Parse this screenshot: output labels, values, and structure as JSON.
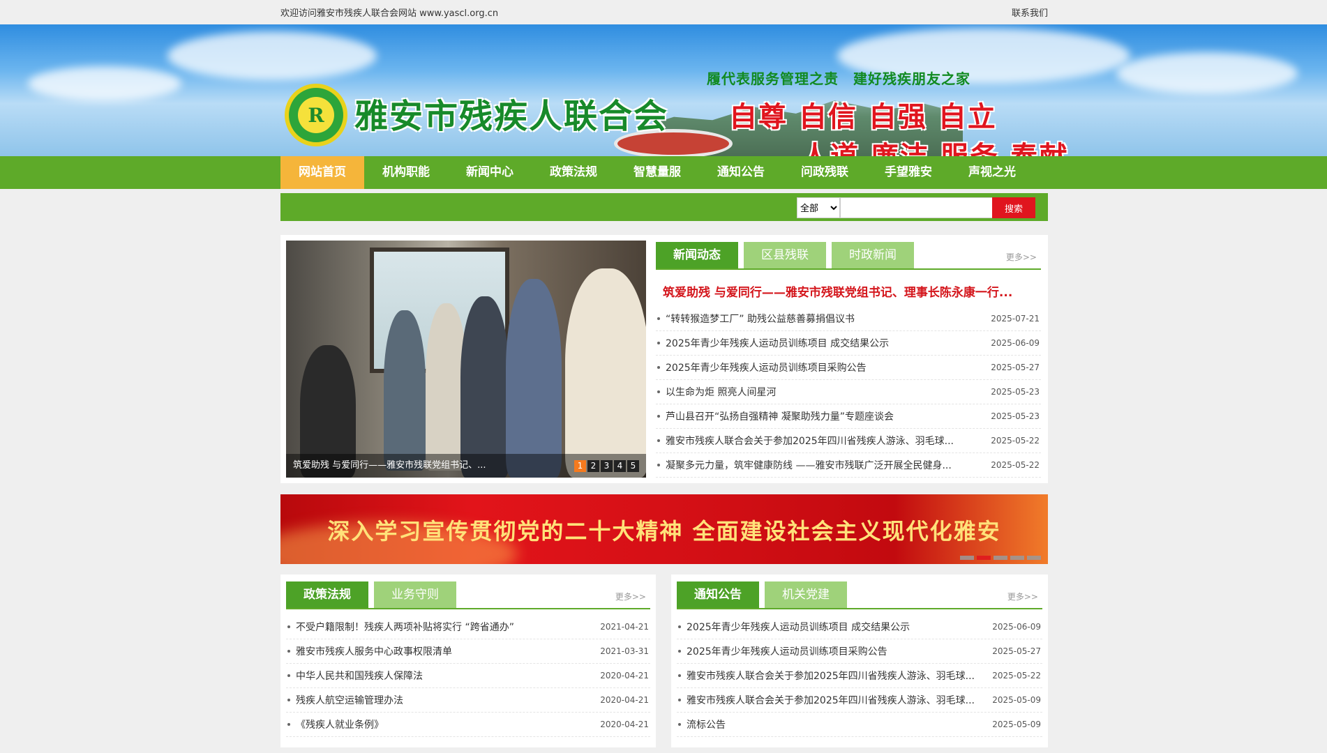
{
  "topbar": {
    "welcome": "欢迎访问雅安市残疾人联合会网站 www.yascl.org.cn",
    "contact": "联系我们"
  },
  "header": {
    "logo_char": "R",
    "org_name": "雅安市残疾人联合会",
    "slogan1": "履代表服务管理之责　建好残疾朋友之家",
    "slogan2": "自尊 自信 自强 自立",
    "slogan3": "人道 廉洁 服务 奉献"
  },
  "nav": {
    "items": [
      {
        "label": "网站首页",
        "active": true
      },
      {
        "label": "机构职能"
      },
      {
        "label": "新闻中心"
      },
      {
        "label": "政策法规"
      },
      {
        "label": "智慧量服"
      },
      {
        "label": "通知公告"
      },
      {
        "label": "问政残联"
      },
      {
        "label": "手望雅安"
      },
      {
        "label": "声视之光"
      }
    ]
  },
  "search": {
    "scope": "全部",
    "button": "搜索"
  },
  "carousel": {
    "caption": "筑爱助残 与爱同行——雅安市残联党组书记、...",
    "pages": [
      "1",
      "2",
      "3",
      "4",
      "5"
    ]
  },
  "news": {
    "tabs": [
      "新闻动态",
      "区县残联",
      "时政新闻"
    ],
    "more": "更多>>",
    "headline": "筑爱助残 与爱同行——雅安市残联党组书记、理事长陈永康一行...",
    "items": [
      {
        "title": "“转转猴造梦工厂” 助残公益慈善募捐倡议书",
        "date": "2025-07-21"
      },
      {
        "title": "2025年青少年残疾人运动员训练项目 成交结果公示",
        "date": "2025-06-09"
      },
      {
        "title": "2025年青少年残疾人运动员训练项目采购公告",
        "date": "2025-05-27"
      },
      {
        "title": "以生命为炬 照亮人间星河",
        "date": "2025-05-23"
      },
      {
        "title": "芦山县召开“弘扬自强精神 凝聚助残力量”专题座谈会",
        "date": "2025-05-23"
      },
      {
        "title": "雅安市残疾人联合会关于参加2025年四川省残疾人游泳、羽毛球...",
        "date": "2025-05-22"
      },
      {
        "title": "凝聚多元力量，筑牢健康防线 ——雅安市残联广泛开展全民健身...",
        "date": "2025-05-22"
      }
    ]
  },
  "red_banner": {
    "text": "深入学习宣传贯彻党的二十大精神 全面建设社会主义现代化雅安"
  },
  "policy": {
    "tabs": [
      "政策法规",
      "业务守则"
    ],
    "more": "更多>>",
    "items": [
      {
        "title": "不受户籍限制！残疾人两项补贴将实行 “跨省通办”",
        "date": "2021-04-21"
      },
      {
        "title": "雅安市残疾人服务中心政事权限清单",
        "date": "2021-03-31"
      },
      {
        "title": "中华人民共和国残疾人保障法",
        "date": "2020-04-21"
      },
      {
        "title": "残疾人航空运输管理办法",
        "date": "2020-04-21"
      },
      {
        "title": "《残疾人就业条例》",
        "date": "2020-04-21"
      }
    ]
  },
  "notice": {
    "tabs": [
      "通知公告",
      "机关党建"
    ],
    "more": "更多>>",
    "items": [
      {
        "title": "2025年青少年残疾人运动员训练项目 成交结果公示",
        "date": "2025-06-09"
      },
      {
        "title": "2025年青少年残疾人运动员训练项目采购公告",
        "date": "2025-05-27"
      },
      {
        "title": "雅安市残疾人联合会关于参加2025年四川省残疾人游泳、羽毛球...",
        "date": "2025-05-22"
      },
      {
        "title": "雅安市残疾人联合会关于参加2025年四川省残疾人游泳、羽毛球...",
        "date": "2025-05-09"
      },
      {
        "title": "流标公告",
        "date": "2025-05-09"
      }
    ]
  }
}
